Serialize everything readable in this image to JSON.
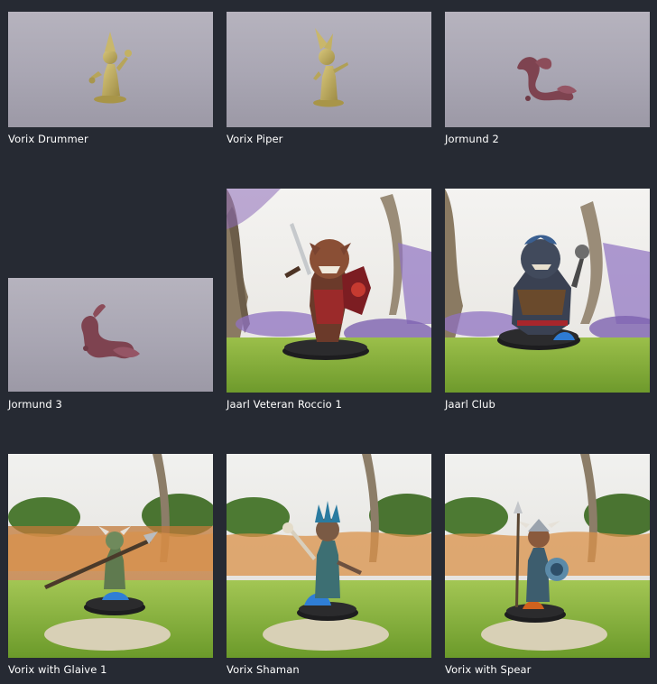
{
  "gallery": {
    "items": [
      {
        "title": "Vorix Drummer",
        "kind": "3d-render",
        "icon": "goblin-figure-icon",
        "color": "#b5a35c"
      },
      {
        "title": "Vorix Piper",
        "kind": "3d-render",
        "icon": "goblin-figure-icon",
        "color": "#b5a35c"
      },
      {
        "title": "Jormund 2",
        "kind": "3d-render",
        "icon": "serpent-figure-icon",
        "color": "#8a4a55"
      },
      {
        "title": "Jormund 3",
        "kind": "3d-render",
        "icon": "serpent-figure-icon",
        "color": "#8a4a55"
      },
      {
        "title": "Jaarl Veteran Roccio 1",
        "kind": "painted-photo",
        "icon": "armored-warrior-figure-icon"
      },
      {
        "title": "Jaarl Club",
        "kind": "painted-photo",
        "icon": "armored-brute-figure-icon"
      },
      {
        "title": "Vorix with Glaive 1",
        "kind": "painted-photo",
        "icon": "goblin-glaive-figure-icon"
      },
      {
        "title": "Vorix Shaman",
        "kind": "painted-photo",
        "icon": "goblin-shaman-figure-icon"
      },
      {
        "title": "Vorix with Spear",
        "kind": "painted-photo",
        "icon": "goblin-spear-figure-icon"
      }
    ]
  }
}
